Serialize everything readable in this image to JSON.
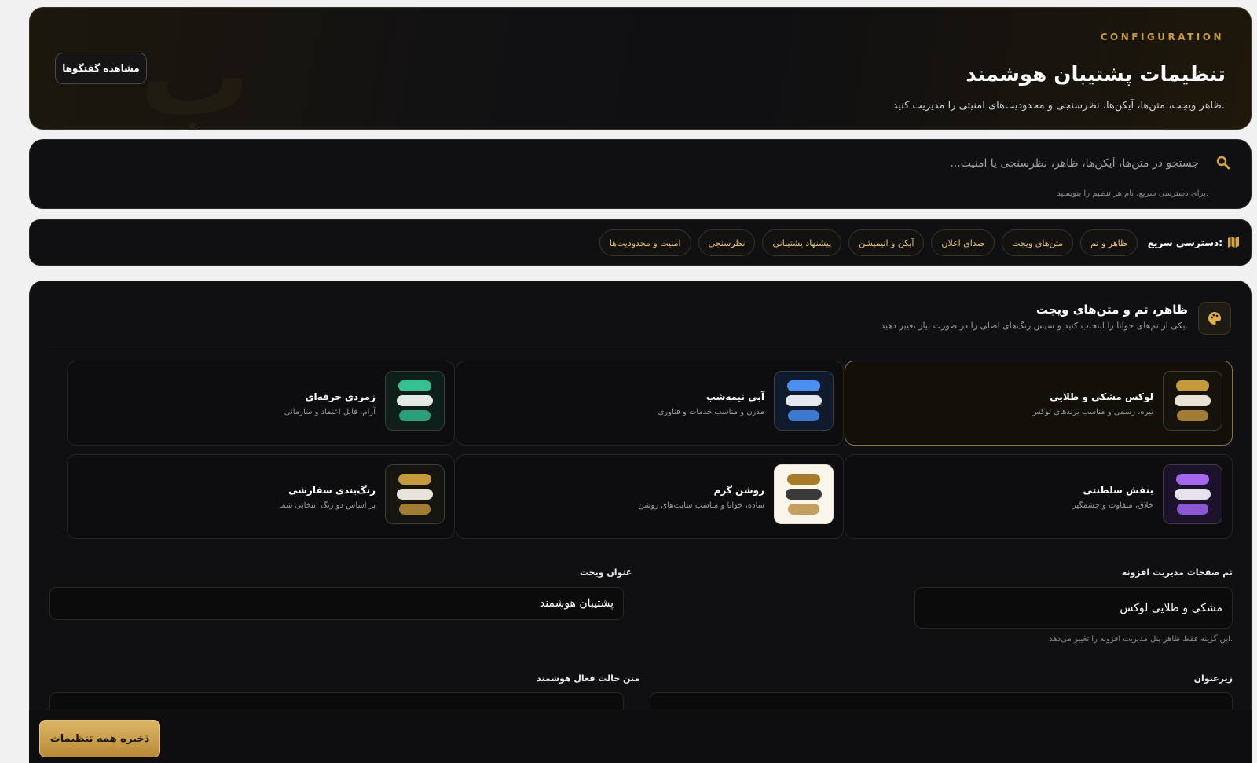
{
  "header": {
    "eyebrow": "CONFIGURATION",
    "title": "تنظیمات پشتیبان هوشمند",
    "subtitle": "ظاهر ویجت، متن‌ها، آیکن‌ها، نظرسنجی و محدودیت‌های امنیتی را مدیریت کنید.",
    "view_conversations_label": "مشاهده گفتگوها"
  },
  "search": {
    "placeholder": "جستجو در متن‌ها، آیکن‌ها، ظاهر، نظرسنجی یا امنیت...",
    "hint": "برای دسترسی سریع، نام هر تنظیم را بنویسید."
  },
  "quick_access": {
    "label": "دسترسی سریع:",
    "items": [
      "ظاهر و تم",
      "متن‌های ویجت",
      "صدای اعلان",
      "آیکن و انیمیشن",
      "پیشنهاد پشتیبانی",
      "نظرسنجی",
      "امنیت و محدودیت‌ها"
    ]
  },
  "section": {
    "title": "ظاهر، تم و متن‌های ویجت",
    "description": "یکی از تم‌های خوانا را انتخاب کنید و سپس رنگ‌های اصلی را در صورت نیاز تغییر دهید."
  },
  "themes": [
    {
      "name": "لوکس مشکی و طلایی",
      "desc": "تیره، رسمی و مناسب برندهای لوکس",
      "selected": true,
      "bg": "#16130c",
      "colors": [
        "#c69a3c",
        "#e8e2d4",
        "#a07c35"
      ]
    },
    {
      "name": "آبی نیمه‌شب",
      "desc": "مدرن و مناسب خدمات و فناوری",
      "selected": false,
      "bg": "#0f1a2c",
      "colors": [
        "#4c8ff0",
        "#e3e8f0",
        "#3e78cf"
      ]
    },
    {
      "name": "زمردی حرفه‌ای",
      "desc": "آرام، قابل اعتماد و سازمانی",
      "selected": false,
      "bg": "#0e1f1a",
      "colors": [
        "#34c08f",
        "#e2e8e4",
        "#2aa07a"
      ]
    },
    {
      "name": "بنفش سلطنتی",
      "desc": "خلاق، متفاوت و چشمگیر",
      "selected": false,
      "bg": "#1d122c",
      "colors": [
        "#a467f0",
        "#e6e2ee",
        "#8a58d0"
      ]
    },
    {
      "name": "روشن گرم",
      "desc": "ساده، خوانا و مناسب سایت‌های روشن",
      "selected": false,
      "bg": "#faf6ec",
      "colors": [
        "#a97a28",
        "#3a3a3a",
        "#c4a060"
      ]
    },
    {
      "name": "رنگ‌بندی سفارشی",
      "desc": "بر اساس دو رنگ انتخابی شما",
      "selected": false,
      "bg": "#16140f",
      "colors": [
        "#c69a3c",
        "#e8e4dc",
        "#a07c35"
      ]
    }
  ],
  "fields": {
    "admin_theme_label": "تم صفحات مدیریت افزونه",
    "admin_theme_value": "مشکی و طلایی لوکس",
    "admin_theme_help": "این گزینه فقط ظاهر پنل مدیریت افزونه را تغییر می‌دهد.",
    "widget_title_label": "عنوان ویجت",
    "widget_title_value": "پشتیبان هوشمند",
    "subtitle_label": "زیرعنوان",
    "smart_active_label": "متن حالت فعال هوشمند"
  },
  "footer": {
    "save_label": "ذخیره همه تنظیمات"
  }
}
